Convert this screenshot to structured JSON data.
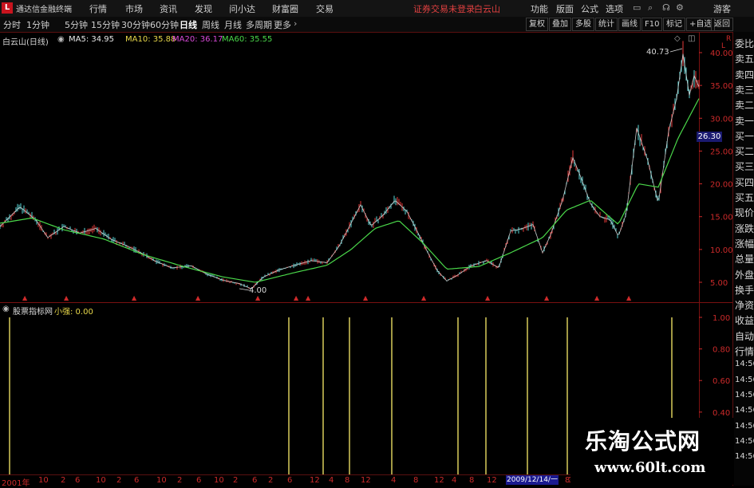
{
  "menu": {
    "app_title": "通达信金融终端",
    "items": [
      "行情",
      "市场",
      "资讯",
      "发现",
      "问小达",
      "财富圈",
      "交易"
    ],
    "login_status": "证券交易未登录",
    "stock_name": "白云山",
    "right_items": [
      "功能",
      "版面",
      "公式",
      "选项"
    ],
    "guest": "游客"
  },
  "toolbar": {
    "periods": [
      "分时",
      "1分钟",
      "5分钟",
      "15分钟",
      "30分钟",
      "60分钟",
      "日线",
      "周线",
      "月线",
      "多周期",
      "更多"
    ],
    "active_period": "日线",
    "right_buttons": [
      "复权",
      "叠加",
      "多股",
      "统计",
      "画线",
      "F10",
      "标记",
      "+自选",
      "返回"
    ]
  },
  "main_chart": {
    "title": "白云山(日线)",
    "ma_legend": [
      {
        "label": "MA5: 34.95",
        "color": "#e8e8e8"
      },
      {
        "label": "MA10: 35.88",
        "color": "#e8d84a"
      },
      {
        "label": "MA20: 36.17",
        "color": "#d84ad8"
      },
      {
        "label": "MA60: 35.55",
        "color": "#4ad84a"
      }
    ],
    "high_label": "40.73",
    "low_label": "4.00",
    "current_price": "26.30",
    "y_ticks": [
      "40.00",
      "35.00",
      "30.00",
      "25.00",
      "20.00",
      "15.00",
      "10.00",
      "5.00"
    ],
    "corner_labels": [
      "L",
      "R"
    ]
  },
  "chart_data": {
    "type": "line",
    "title": "白云山(日线)",
    "ylim": [
      2.5,
      42
    ],
    "series": [
      {
        "name": "MA5",
        "color": "#e8e8e8",
        "values": []
      },
      {
        "name": "MA60",
        "color": "#4ad84a",
        "values": []
      }
    ],
    "price_path": [
      [
        0,
        13.5
      ],
      [
        25,
        16.5
      ],
      [
        45,
        14.5
      ],
      [
        60,
        11.8
      ],
      [
        80,
        13.5
      ],
      [
        100,
        12.5
      ],
      [
        120,
        13.2
      ],
      [
        140,
        11.5
      ],
      [
        160,
        10.5
      ],
      [
        175,
        9.6
      ],
      [
        195,
        8.2
      ],
      [
        215,
        7.2
      ],
      [
        240,
        7.5
      ],
      [
        260,
        6.2
      ],
      [
        280,
        5.3
      ],
      [
        300,
        4.8
      ],
      [
        315,
        4.0
      ],
      [
        330,
        5.8
      ],
      [
        350,
        6.9
      ],
      [
        370,
        7.6
      ],
      [
        390,
        8.3
      ],
      [
        410,
        8.0
      ],
      [
        425,
        10.5
      ],
      [
        440,
        14.0
      ],
      [
        452,
        16.8
      ],
      [
        465,
        13.6
      ],
      [
        480,
        15.2
      ],
      [
        495,
        17.5
      ],
      [
        510,
        15.8
      ],
      [
        522,
        13.0
      ],
      [
        535,
        9.8
      ],
      [
        548,
        6.8
      ],
      [
        560,
        5.2
      ],
      [
        575,
        6.2
      ],
      [
        590,
        7.5
      ],
      [
        610,
        8.3
      ],
      [
        625,
        7.2
      ],
      [
        640,
        12.8
      ],
      [
        655,
        13.2
      ],
      [
        668,
        13.8
      ],
      [
        680,
        9.5
      ],
      [
        690,
        12.2
      ],
      [
        705,
        17.5
      ],
      [
        718,
        24.0
      ],
      [
        728,
        21.0
      ],
      [
        740,
        17.0
      ],
      [
        752,
        15.0
      ],
      [
        765,
        14.5
      ],
      [
        775,
        12.0
      ],
      [
        785,
        15.5
      ],
      [
        798,
        28.5
      ],
      [
        812,
        23.5
      ],
      [
        825,
        17.0
      ],
      [
        838,
        28.0
      ],
      [
        848,
        33.0
      ],
      [
        856,
        39.8
      ],
      [
        864,
        33.5
      ],
      [
        870,
        36.5
      ],
      [
        876,
        34.8
      ]
    ],
    "ma60_path": [
      [
        0,
        14.0
      ],
      [
        40,
        14.8
      ],
      [
        80,
        13.0
      ],
      [
        130,
        11.6
      ],
      [
        180,
        9.2
      ],
      [
        230,
        7.4
      ],
      [
        280,
        5.8
      ],
      [
        320,
        5.0
      ],
      [
        370,
        6.5
      ],
      [
        410,
        7.6
      ],
      [
        440,
        10.0
      ],
      [
        470,
        13.2
      ],
      [
        500,
        14.4
      ],
      [
        530,
        11.0
      ],
      [
        560,
        7.0
      ],
      [
        600,
        7.4
      ],
      [
        640,
        9.5
      ],
      [
        680,
        11.8
      ],
      [
        710,
        16.0
      ],
      [
        740,
        17.5
      ],
      [
        775,
        13.8
      ],
      [
        800,
        20.0
      ],
      [
        825,
        19.5
      ],
      [
        850,
        27.0
      ],
      [
        876,
        33.0
      ]
    ]
  },
  "indicator": {
    "name": "股票指标网",
    "label": "小强: 0.00",
    "y_ticks": [
      "1.00",
      "0.80",
      "0.60",
      "0.40"
    ],
    "signals": [
      12,
      362,
      405,
      438,
      491,
      574,
      609,
      661,
      711,
      842
    ]
  },
  "info_panel": {
    "rows": [
      "委比",
      "卖五",
      "卖四",
      "卖三",
      "卖二",
      "卖一",
      "买一",
      "买二",
      "买三",
      "买四",
      "买五",
      "现价",
      "涨跌",
      "涨幅",
      "总量",
      "外盘",
      "换手",
      "净资",
      "收益",
      "自动",
      "行情",
      "14:56",
      "14:56",
      "14:56",
      "14:56",
      "14:56",
      "14:56",
      "14:56"
    ]
  },
  "date_axis": {
    "labels": [
      "2001年",
      "10",
      "2",
      "6",
      "10",
      "2",
      "6",
      "10",
      "2",
      "6",
      "10",
      "2",
      "6",
      "2",
      "6",
      "12",
      "4",
      "8",
      "12",
      "4",
      "8",
      "12",
      "4",
      "8",
      "12",
      "4",
      "8",
      "12"
    ],
    "highlight": "2009/12/14/一"
  },
  "watermark": {
    "title": "乐淘公式网",
    "url": "www.60lt.com"
  }
}
